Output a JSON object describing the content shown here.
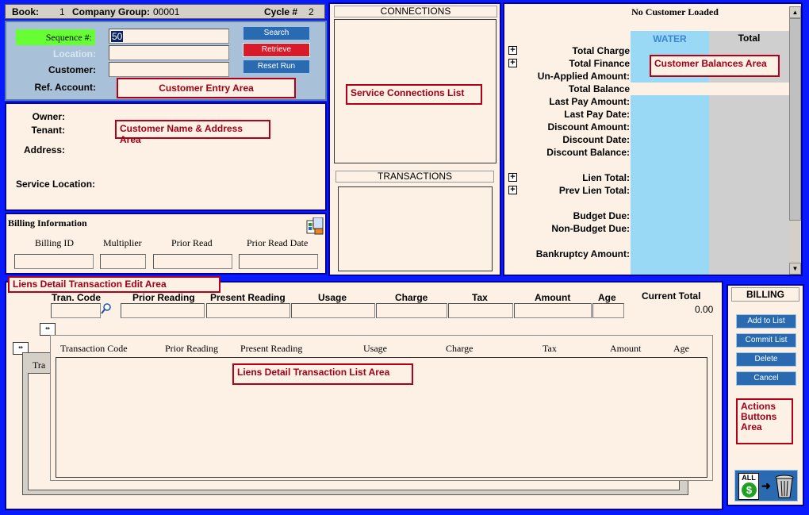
{
  "topbar": {
    "book_label": "Book:",
    "book_value": "1",
    "company_label": "Company Group:",
    "company_value": "00001",
    "cycle_label": "Cycle #",
    "cycle_value": "2"
  },
  "entry": {
    "sequence_label": "Sequence #:",
    "sequence_value": "50",
    "location_label": "Location:",
    "customer_label": "Customer:",
    "ref_label": "Ref. Account:",
    "search_btn": "Search",
    "retrieve_btn": "Retrieve",
    "reset_btn": "Reset Run",
    "area_label": "Customer Entry Area"
  },
  "name_area": {
    "owner": "Owner:",
    "tenant": "Tenant:",
    "address": "Address:",
    "service_location": "Service Location:",
    "area_label": "Customer Name & Address Area"
  },
  "billing_info": {
    "title": "Billing Information",
    "cols": [
      "Billing ID",
      "Multiplier",
      "Prior Read",
      "Prior Read Date"
    ]
  },
  "connections": {
    "title": "CONNECTIONS",
    "area_label": "Service Connections List"
  },
  "transactions": {
    "title": "TRANSACTIONS"
  },
  "balances": {
    "header": "No Customer Loaded",
    "col_water": "WATER",
    "col_total": "Total",
    "rows": [
      "Total Charge",
      "Total Finance",
      "Un-Applied Amount:",
      "Total Balance",
      "Last Pay Amount:",
      "Last Pay Date:",
      "Discount Amount:",
      "Discount Date:",
      "Discount Balance:",
      "Lien Total:",
      "Prev Lien Total:",
      "Budget Due:",
      "Non-Budget Due:",
      "Bankruptcy Amount:"
    ],
    "area_label": "Customer Balances Area"
  },
  "liens": {
    "edit_area_label": "Liens Detail Transaction Edit Area",
    "edit_cols": [
      "Tran. Code",
      "Prior Reading",
      "Present Reading",
      "Usage",
      "Charge",
      "Tax",
      "Amount",
      "Age"
    ],
    "current_total_label": "Current Total",
    "current_total_value": "0.00",
    "list_cols": [
      "Transaction Code",
      "Prior Reading",
      "Present Reading",
      "Usage",
      "Charge",
      "Tax",
      "Amount",
      "Age"
    ],
    "list_area_label": "Liens Detail Transaction List Area",
    "bg_col": "Tra"
  },
  "actions": {
    "title": "BILLING",
    "add": "Add to List",
    "commit": "Commit List",
    "delete": "Delete",
    "cancel": "Cancel",
    "area_label": "Actions Buttons Area",
    "all_label": "ALL"
  }
}
